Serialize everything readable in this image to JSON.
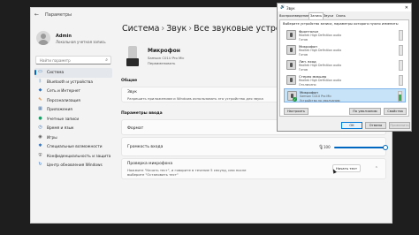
{
  "window": {
    "title": "Параметры"
  },
  "user": {
    "name": "Admin",
    "account": "Локальная учетная запись"
  },
  "search": {
    "placeholder": "Найти параметр"
  },
  "nav": [
    {
      "label": "Система",
      "icon": "monitor-icon",
      "color": "#0067c0",
      "active": true
    },
    {
      "label": "Bluetooth и устройства",
      "icon": "bluetooth-icon",
      "color": "#0067c0"
    },
    {
      "label": "Сеть и Интернет",
      "icon": "wifi-icon",
      "color": "#2f6fbd"
    },
    {
      "label": "Персонализация",
      "icon": "brush-icon",
      "color": "#c9741c"
    },
    {
      "label": "Приложения",
      "icon": "apps-icon",
      "color": "#3b6ea8"
    },
    {
      "label": "Учетные записи",
      "icon": "person-icon",
      "color": "#1f9e6a"
    },
    {
      "label": "Время и язык",
      "icon": "clock-icon",
      "color": "#2f6fbd"
    },
    {
      "label": "Игры",
      "icon": "gamepad-icon",
      "color": "#555555"
    },
    {
      "label": "Специальные возможности",
      "icon": "accessibility-icon",
      "color": "#2f6fbd"
    },
    {
      "label": "Конфиденциальность и защита",
      "icon": "shield-icon",
      "color": "#555555"
    },
    {
      "label": "Центр обновления Windows",
      "icon": "update-icon",
      "color": "#2f6fbd"
    }
  ],
  "breadcrumb": {
    "a": "Система",
    "b": "Звук",
    "c": "Все звуковые устройства",
    "sep": "›"
  },
  "device": {
    "name": "Микрофон",
    "model": "Samson C01U Pro Mic",
    "status": "Переименовать"
  },
  "sections": {
    "general": "Общие",
    "input": "Параметры ввода"
  },
  "audio_card": {
    "title": "Звук",
    "subtitle": "Разрешить приложениям и Windows использовать это устройство для звука"
  },
  "format_card": {
    "title": "Формат"
  },
  "volume_card": {
    "title": "Громкость входа",
    "value": "100",
    "level_percent": 100
  },
  "test_card": {
    "title": "Проверка микрофона",
    "subtitle1": "Нажмите \"Начать тест\", и говорите в течение 5 секунд, или после",
    "subtitle2": "выберите \"Остановить тест\"",
    "button": "Начать тест"
  },
  "dialog": {
    "title": "Звук",
    "tabs": [
      "Воспроизведение",
      "Запись",
      "Звуки",
      "Связь"
    ],
    "active_tab": 1,
    "instruction": "Выберите устройство записи, параметры которого нужно изменить:",
    "devices": [
      {
        "name": "Фронтальн",
        "driver": "Realtek High Definition audio",
        "status": "Готов",
        "level_percent": 0
      },
      {
        "name": "Микрофон",
        "driver": "Realtek High Definition audio",
        "status": "Готов",
        "level_percent": 0
      },
      {
        "name": "Лин. вход",
        "driver": "Realtek High Definition audio",
        "status": "Готов",
        "level_percent": 0
      },
      {
        "name": "Стерео микшер",
        "driver": "Realtek High Definition audio",
        "status": "Отключено",
        "level_percent": 0
      },
      {
        "name": "Микрофон",
        "driver": "Samson C01U Pro Mic",
        "status": "Устройство по умолчанию",
        "level_percent": 70,
        "selected": true
      }
    ],
    "buttons": {
      "configure": "Настроить",
      "default": "По умолчанию",
      "properties": "Свойства",
      "ok": "OK",
      "cancel": "Отмена",
      "apply": "Применить"
    }
  },
  "colors": {
    "accent": "#0067c0",
    "meter": "#2ab34b"
  }
}
